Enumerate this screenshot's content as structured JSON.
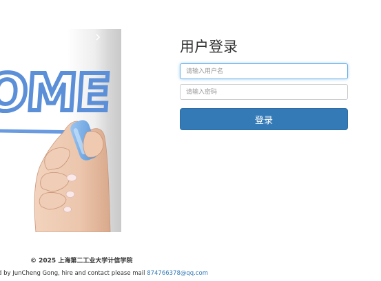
{
  "hero": {
    "banner_text": "OME"
  },
  "login": {
    "title": "用户登录",
    "username_placeholder": "请输入用户名",
    "password_placeholder": "请输入密码",
    "submit_label": "登录"
  },
  "footer": {
    "copyright": "© 2025 上海第二工业大学计信学院",
    "credit_text": "d by JunCheng Gong, hire and contact please mail ",
    "email": "874766378@qq.com"
  },
  "colors": {
    "primary": "#337ab7",
    "focus_border": "#66afe9",
    "banner_blue": "#5b8fd8"
  }
}
